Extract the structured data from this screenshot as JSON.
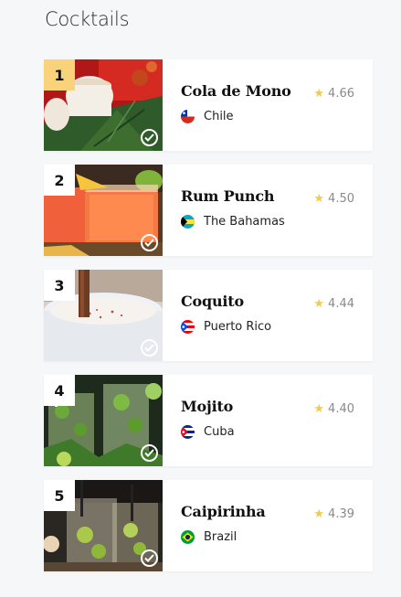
{
  "page": {
    "title": "Cocktails"
  },
  "cocktails": [
    {
      "rank": "1",
      "name": "Cola de Mono",
      "country": "Chile",
      "rating": "4.66",
      "flag": "chile-flag-icon",
      "photo": "cola-de-mono-photo"
    },
    {
      "rank": "2",
      "name": "Rum Punch",
      "country": "The Bahamas",
      "rating": "4.50",
      "flag": "bahamas-flag-icon",
      "photo": "rum-punch-photo"
    },
    {
      "rank": "3",
      "name": "Coquito",
      "country": "Puerto Rico",
      "rating": "4.44",
      "flag": "puerto-rico-flag-icon",
      "photo": "coquito-photo"
    },
    {
      "rank": "4",
      "name": "Mojito",
      "country": "Cuba",
      "rating": "4.40",
      "flag": "cuba-flag-icon",
      "photo": "mojito-photo"
    },
    {
      "rank": "5",
      "name": "Caipirinha",
      "country": "Brazil",
      "rating": "4.39",
      "flag": "brazil-flag-icon",
      "photo": "caipirinha-photo"
    }
  ],
  "colors": {
    "rank_highlight": "#f8d37a",
    "star": "#f7c948"
  },
  "icons": {
    "rating": "star-icon",
    "visited": "checkmark-circle-icon"
  }
}
